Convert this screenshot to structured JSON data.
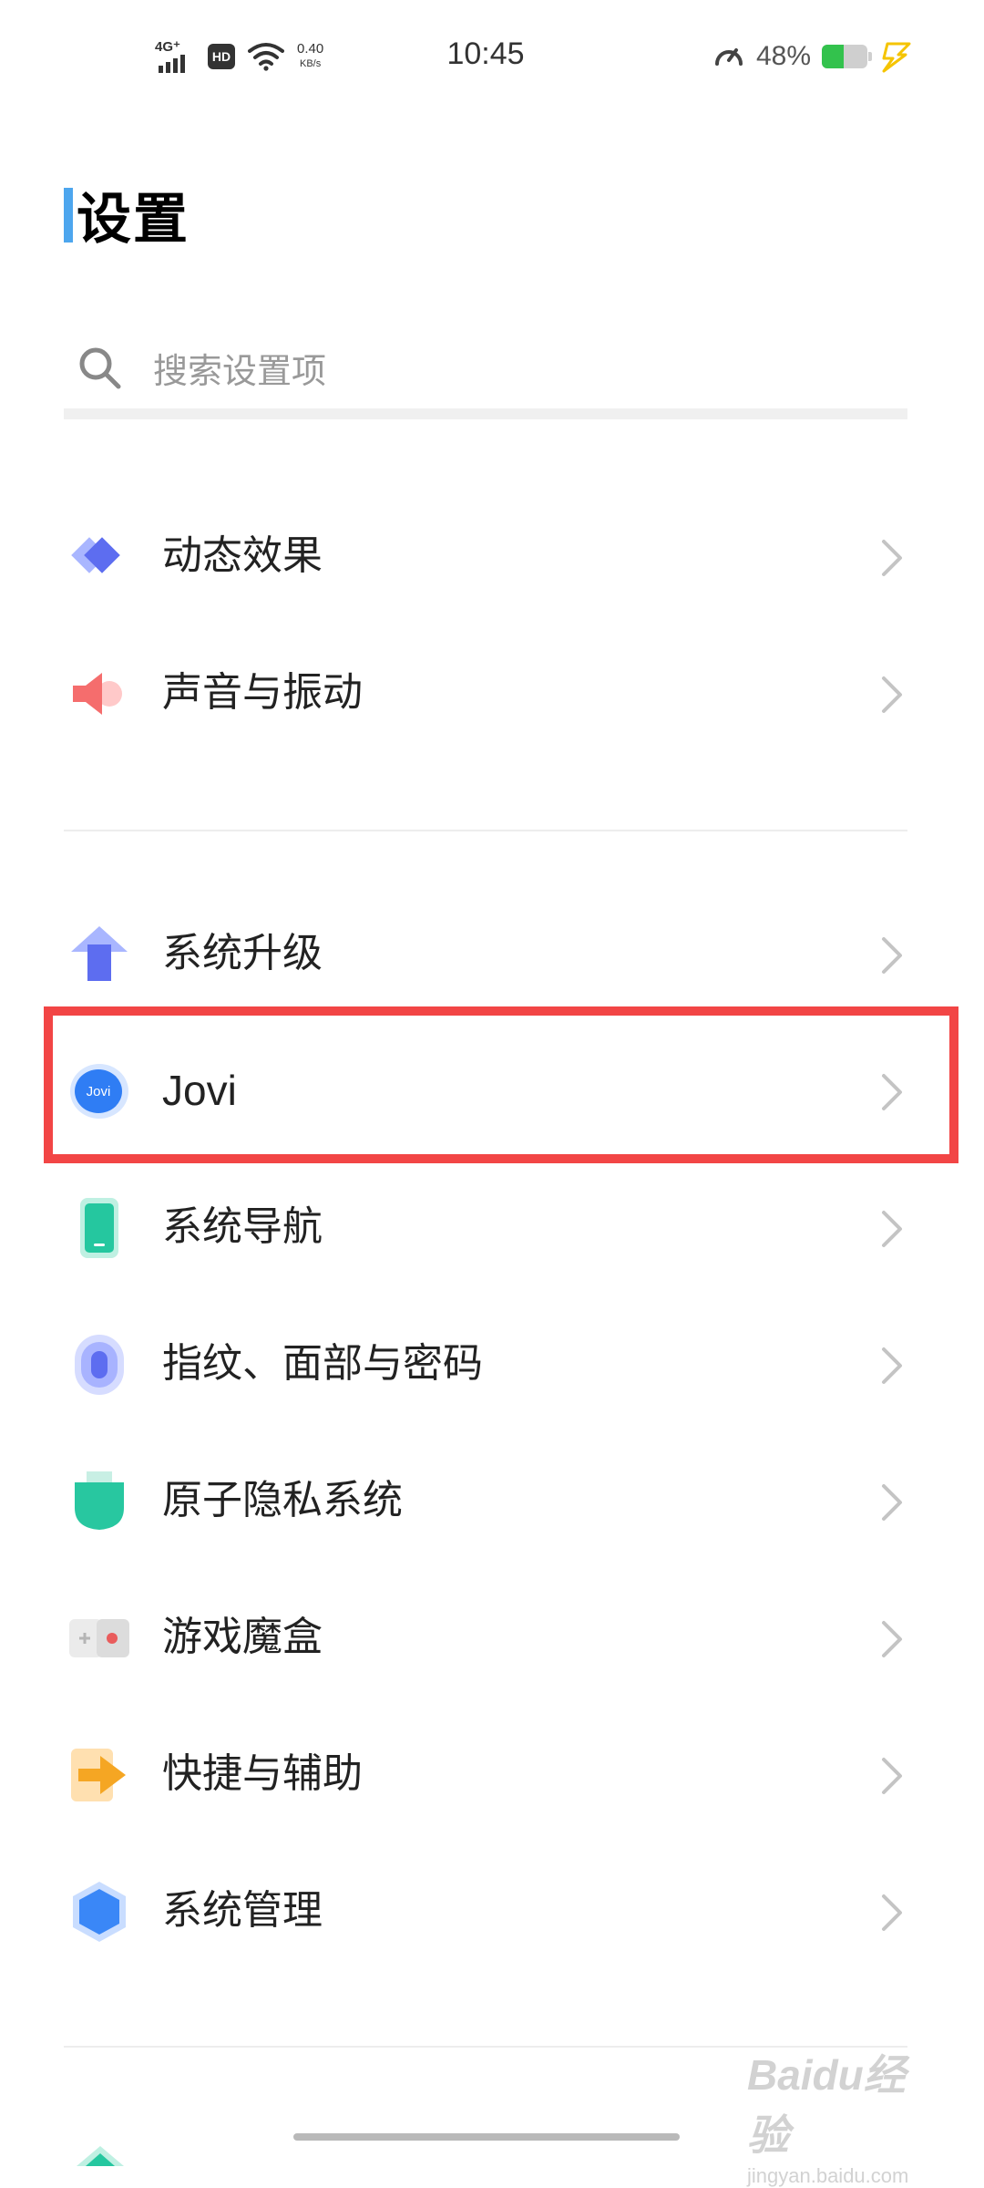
{
  "status_bar": {
    "network": "4G⁺",
    "hd": "HD",
    "speed_value": "0.40",
    "speed_unit": "KB/s",
    "time": "10:45",
    "battery_percent": "48%",
    "battery_level": 0.48
  },
  "page": {
    "title": "设置"
  },
  "search": {
    "placeholder": "搜索设置项"
  },
  "groups": [
    {
      "items": [
        {
          "label": "动态效果",
          "icon": "motion-effect-icon"
        },
        {
          "label": "声音与振动",
          "icon": "speaker-icon"
        }
      ]
    },
    {
      "items": [
        {
          "label": "系统升级",
          "icon": "upgrade-arrow-icon"
        },
        {
          "label": "Jovi",
          "icon": "jovi-icon"
        },
        {
          "label": "系统导航",
          "icon": "phone-navigation-icon"
        },
        {
          "label": "指纹、面部与密码",
          "icon": "fingerprint-icon"
        },
        {
          "label": "原子隐私系统",
          "icon": "privacy-shield-icon"
        },
        {
          "label": "游戏魔盒",
          "icon": "game-box-icon"
        },
        {
          "label": "快捷与辅助",
          "icon": "shortcut-arrow-icon"
        },
        {
          "label": "系统管理",
          "icon": "hexagon-icon"
        }
      ]
    }
  ],
  "jovi_logo_text": "Jovi",
  "watermark": {
    "main": "Baidu经验",
    "sub": "jingyan.baidu.com"
  },
  "colors": {
    "accent": "#4da6ee",
    "highlight_border": "#f24545",
    "battery_fill": "#33c24d"
  }
}
